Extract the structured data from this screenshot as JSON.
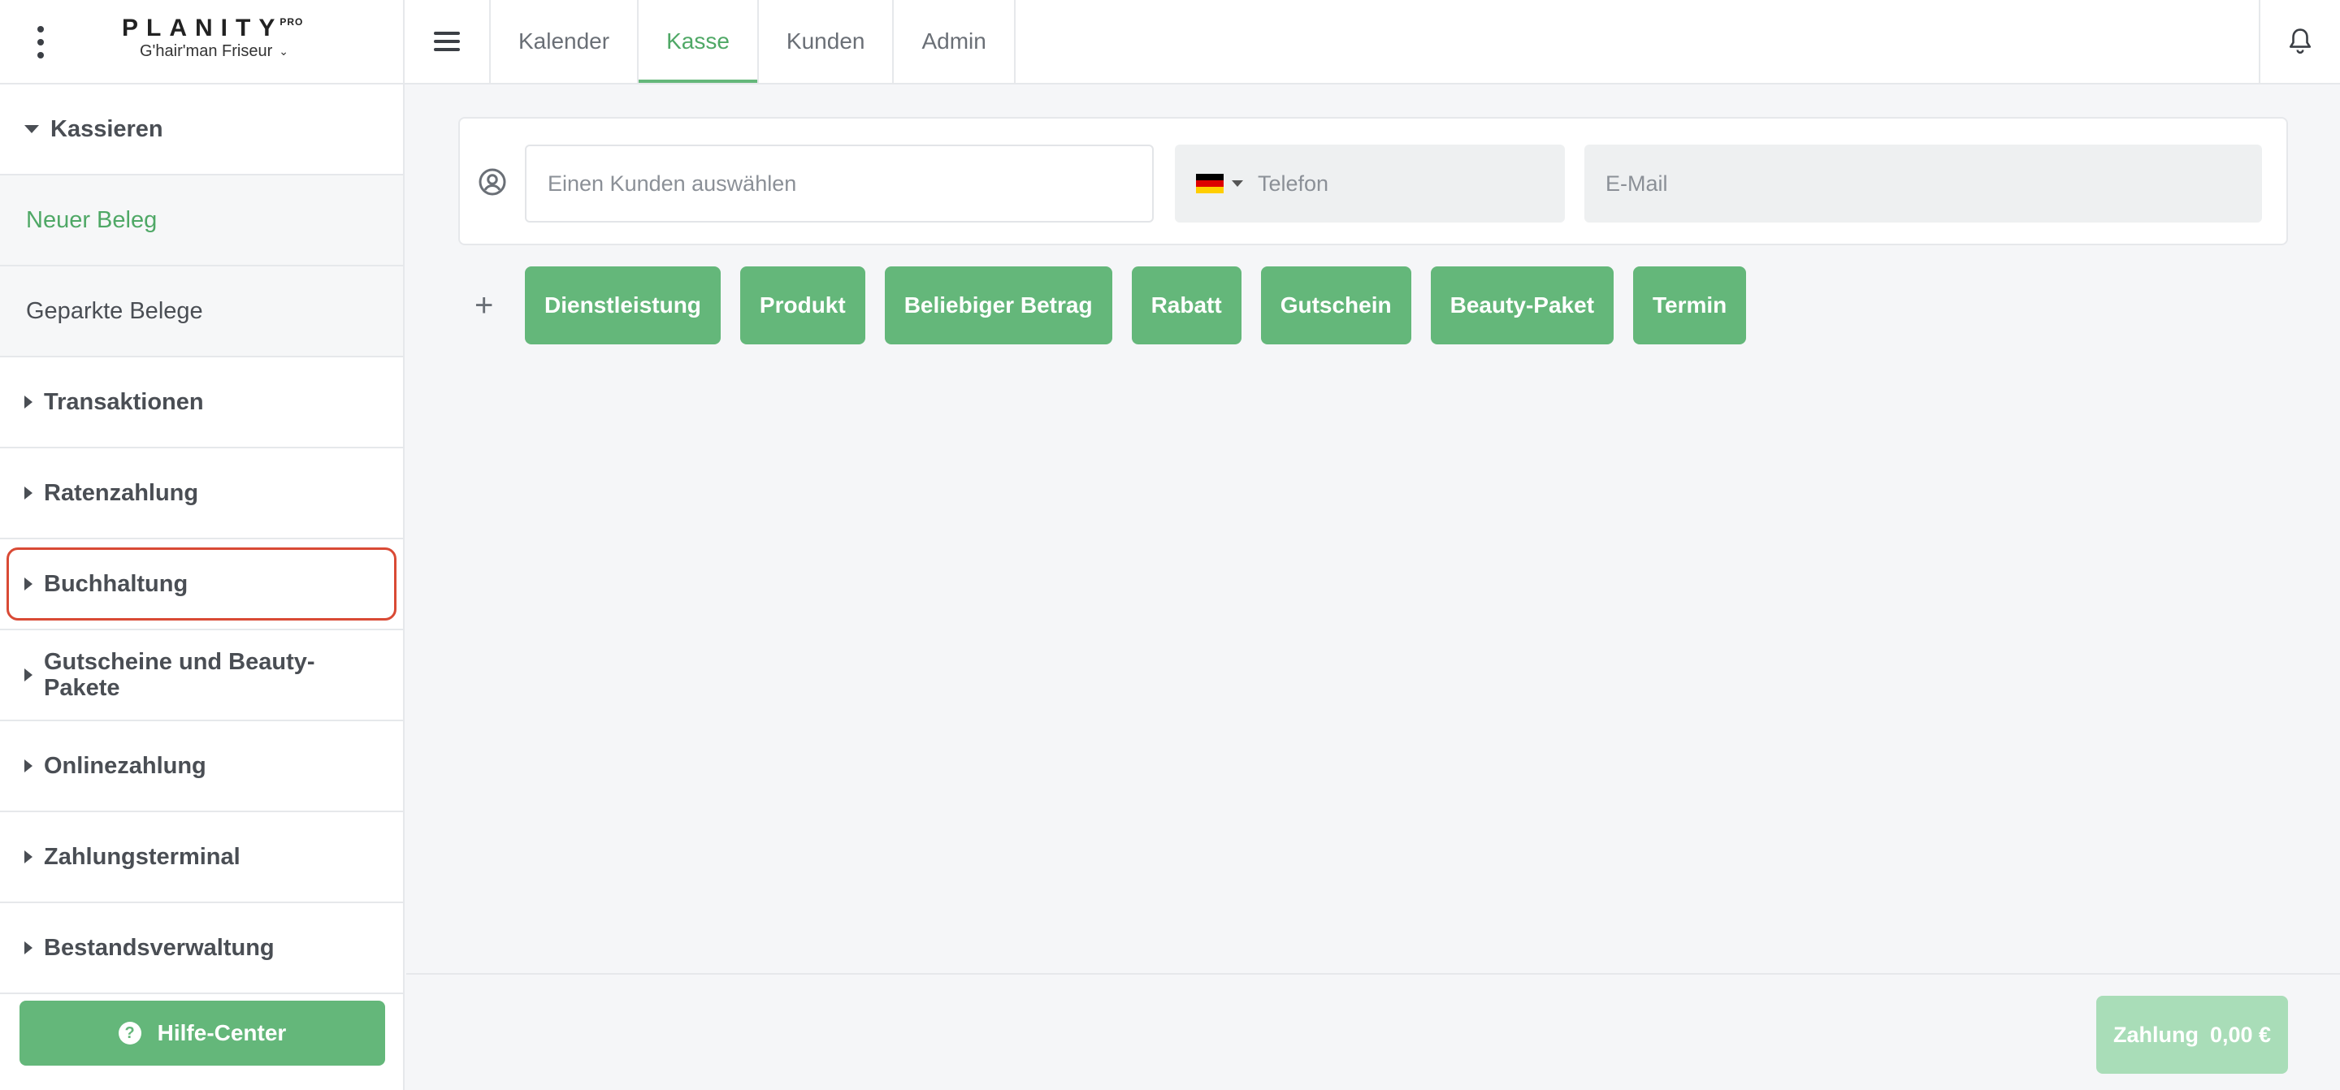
{
  "app": {
    "logo": "PLANITY",
    "logo_badge": "PRO",
    "salon_name": "G'hair'man Friseur"
  },
  "sidebar": {
    "items": [
      {
        "label": "Kassieren",
        "type": "group-open"
      },
      {
        "label": "Neuer Beleg",
        "type": "sub-active"
      },
      {
        "label": "Geparkte Belege",
        "type": "sub"
      },
      {
        "label": "Transaktionen",
        "type": "group"
      },
      {
        "label": "Ratenzahlung",
        "type": "group"
      },
      {
        "label": "Buchhaltung",
        "type": "group-highlighted"
      },
      {
        "label": "Gutscheine und Beauty-Pakete",
        "type": "group"
      },
      {
        "label": "Onlinezahlung",
        "type": "group"
      },
      {
        "label": "Zahlungsterminal",
        "type": "group"
      },
      {
        "label": "Bestandsverwaltung",
        "type": "group"
      }
    ],
    "help_label": "Hilfe-Center"
  },
  "topbar": {
    "tabs": [
      {
        "label": "Kalender",
        "active": false
      },
      {
        "label": "Kasse",
        "active": true
      },
      {
        "label": "Kunden",
        "active": false
      },
      {
        "label": "Admin",
        "active": false
      }
    ]
  },
  "customer": {
    "customer_placeholder": "Einen Kunden auswählen",
    "phone_placeholder": "Telefon",
    "email_placeholder": "E-Mail",
    "country_flag": "de"
  },
  "actions": {
    "add_symbol": "+",
    "buttons": [
      "Dienstleistung",
      "Produkt",
      "Beliebiger Betrag",
      "Rabatt",
      "Gutschein",
      "Beauty-Paket",
      "Termin"
    ]
  },
  "footer": {
    "pay_label": "Zahlung",
    "pay_amount": "0,00 €"
  },
  "colors": {
    "accent": "#64b77a",
    "accent_disabled": "#a9ddb8",
    "highlight": "#d94a35"
  }
}
